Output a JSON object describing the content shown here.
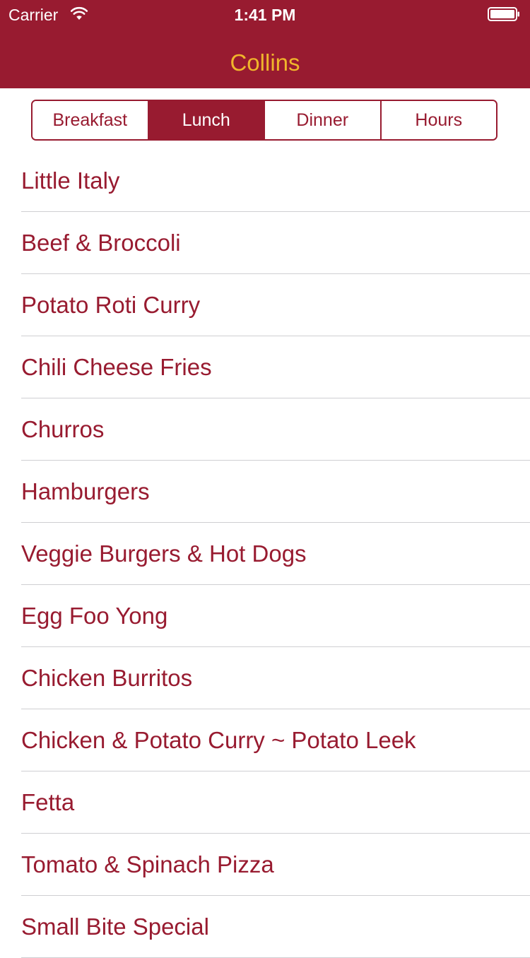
{
  "status_bar": {
    "carrier": "Carrier",
    "time": "1:41 PM",
    "wifi_icon": "wifi-icon",
    "battery_icon": "battery-full-icon"
  },
  "nav": {
    "title": "Collins",
    "bar_color": "#981b30",
    "title_color": "#f0b62b"
  },
  "segmented": {
    "selected_index": 1,
    "segments": [
      "Breakfast",
      "Lunch",
      "Dinner",
      "Hours"
    ]
  },
  "menu_items": [
    "Little Italy",
    "Beef & Broccoli",
    "Potato Roti Curry",
    "Chili Cheese Fries",
    "Churros",
    "Hamburgers",
    "Veggie Burgers & Hot Dogs",
    "Egg Foo Yong",
    "Chicken Burritos",
    "Chicken & Potato Curry ~ Potato Leek",
    "Fetta",
    "Tomato & Spinach Pizza",
    "Small Bite Special"
  ]
}
